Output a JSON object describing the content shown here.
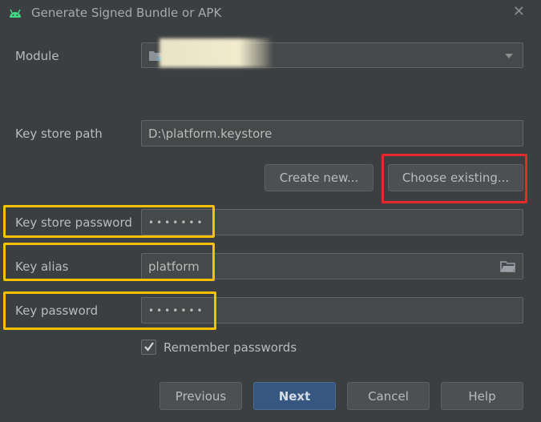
{
  "window": {
    "title": "Generate Signed Bundle or APK",
    "close_label": "✕",
    "app_icon": "android-icon"
  },
  "form": {
    "module_label": "Module",
    "module_value": "",
    "keystore_path_label": "Key store path",
    "keystore_path_value": "D:\\platform.keystore",
    "create_new_label": "Create new...",
    "choose_existing_label": "Choose existing...",
    "keystore_password_label": "Key store password",
    "keystore_password_value": "•••••••",
    "key_alias_label": "Key alias",
    "key_alias_value": "platform",
    "key_password_label": "Key password",
    "key_password_value": "•••••••",
    "remember_passwords_label": "Remember passwords",
    "remember_passwords_checked": true
  },
  "buttons": {
    "previous": "Previous",
    "next": "Next",
    "cancel": "Cancel",
    "help": "Help"
  },
  "colors": {
    "background": "#3c3f41",
    "primary_button": "#365880",
    "highlight_red": "#e8292b",
    "highlight_yellow": "#f5c100"
  }
}
